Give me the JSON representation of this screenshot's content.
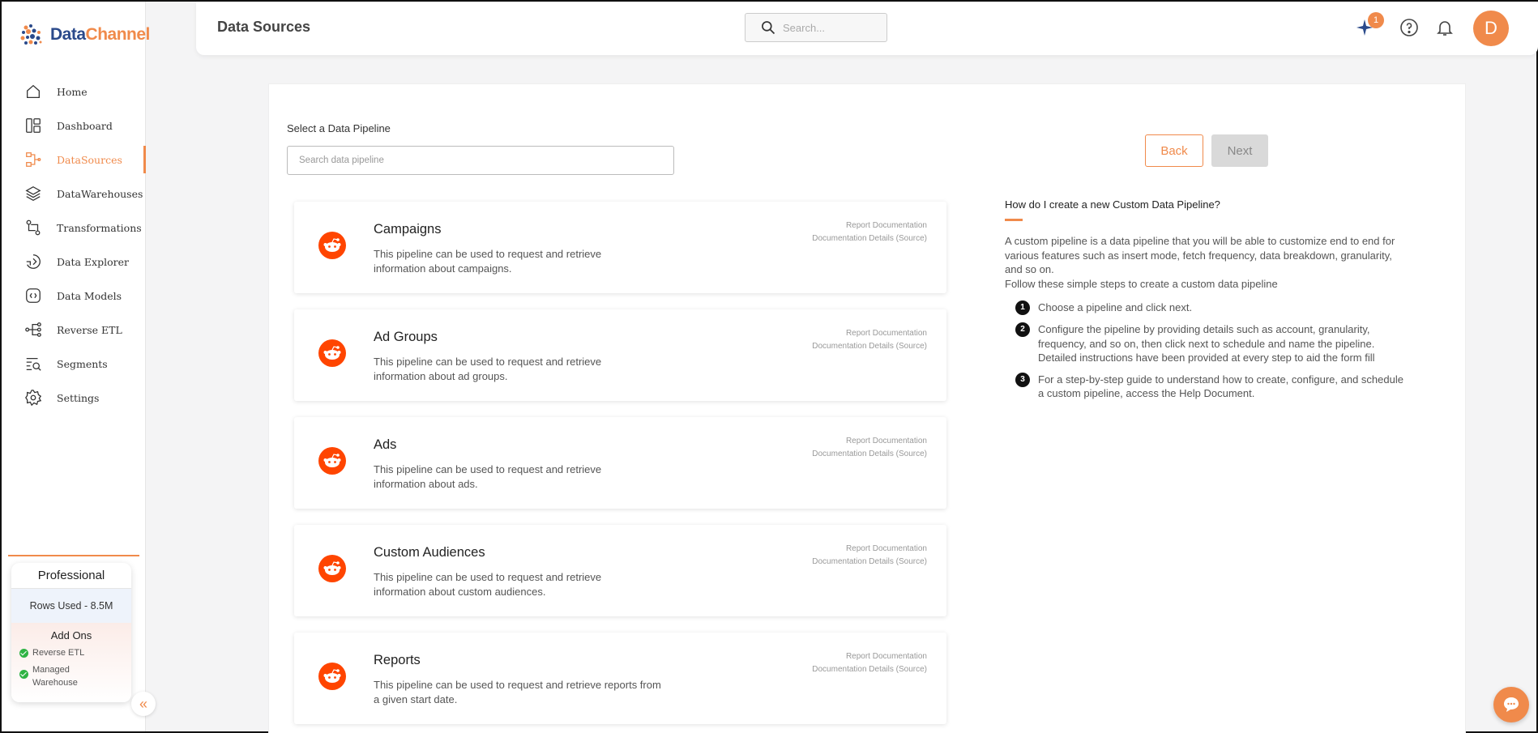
{
  "brand": {
    "name_part1": "Data",
    "name_part2": "Channel",
    "primary_color": "#2b4a8b",
    "accent_color": "#f08a4b"
  },
  "sidebar": {
    "items": [
      {
        "label": "Home",
        "icon": "home-icon"
      },
      {
        "label": "Dashboard",
        "icon": "dashboard-icon"
      },
      {
        "label": "DataSources",
        "icon": "datasources-icon",
        "active": true
      },
      {
        "label": "DataWarehouses",
        "icon": "layers-icon"
      },
      {
        "label": "Transformations",
        "icon": "transform-icon"
      },
      {
        "label": "Data Explorer",
        "icon": "explorer-icon"
      },
      {
        "label": "Data Models",
        "icon": "data-models-icon"
      },
      {
        "label": "Reverse ETL",
        "icon": "reverse-etl-icon"
      },
      {
        "label": "Segments",
        "icon": "segments-icon"
      },
      {
        "label": "Settings",
        "icon": "gear-icon"
      }
    ],
    "plan": {
      "title": "Professional",
      "rows_used": "Rows Used - 8.5M",
      "addons_title": "Add Ons",
      "addons": [
        "Reverse ETL",
        "Managed Warehouse"
      ]
    },
    "collapse_label": "«"
  },
  "header": {
    "title": "Data Sources",
    "search_placeholder": "Search...",
    "notification_badge": "1",
    "avatar_initial": "D"
  },
  "main": {
    "select_label": "Select a Data Pipeline",
    "search_placeholder": "Search data pipeline",
    "back_label": "Back",
    "next_label": "Next",
    "pipelines": [
      {
        "name": "Campaigns",
        "description": "This pipeline can be used to request and retrieve information about campaigns.",
        "link1": "Report Documentation",
        "link2": "Documentation Details (Source)"
      },
      {
        "name": "Ad Groups",
        "description": "This pipeline can be used to request and retrieve information about ad groups.",
        "link1": "Report Documentation",
        "link2": "Documentation Details (Source)"
      },
      {
        "name": "Ads",
        "description": "This pipeline can be used to request and retrieve information about ads.",
        "link1": "Report Documentation",
        "link2": "Documentation Details (Source)"
      },
      {
        "name": "Custom Audiences",
        "description": "This pipeline can be used to request and retrieve information about custom audiences.",
        "link1": "Report Documentation",
        "link2": "Documentation Details (Source)"
      },
      {
        "name": "Reports",
        "description": "This pipeline can be used to request and retrieve reports from a given start date.",
        "link1": "Report Documentation",
        "link2": "Documentation Details (Source)"
      }
    ],
    "help": {
      "title": "How do I create a new Custom Data Pipeline?",
      "paragraph": "A custom pipeline is a data pipeline that you will be able to customize end to end for various features such as insert mode, fetch frequency, data breakdown, granularity, and so on.",
      "intro": "Follow these simple steps to create a custom data pipeline",
      "steps": [
        {
          "num": "1",
          "text": "Choose a pipeline and click next."
        },
        {
          "num": "2",
          "text": "Configure the pipeline by providing details such as account, granularity, frequency, and so on, then click next to schedule and name the pipeline. Detailed instructions have been provided at every step to aid the form fill"
        },
        {
          "num": "3",
          "text": "For a step-by-step guide to understand how to create, configure, and schedule a custom pipeline, access the Help Document."
        }
      ]
    }
  }
}
